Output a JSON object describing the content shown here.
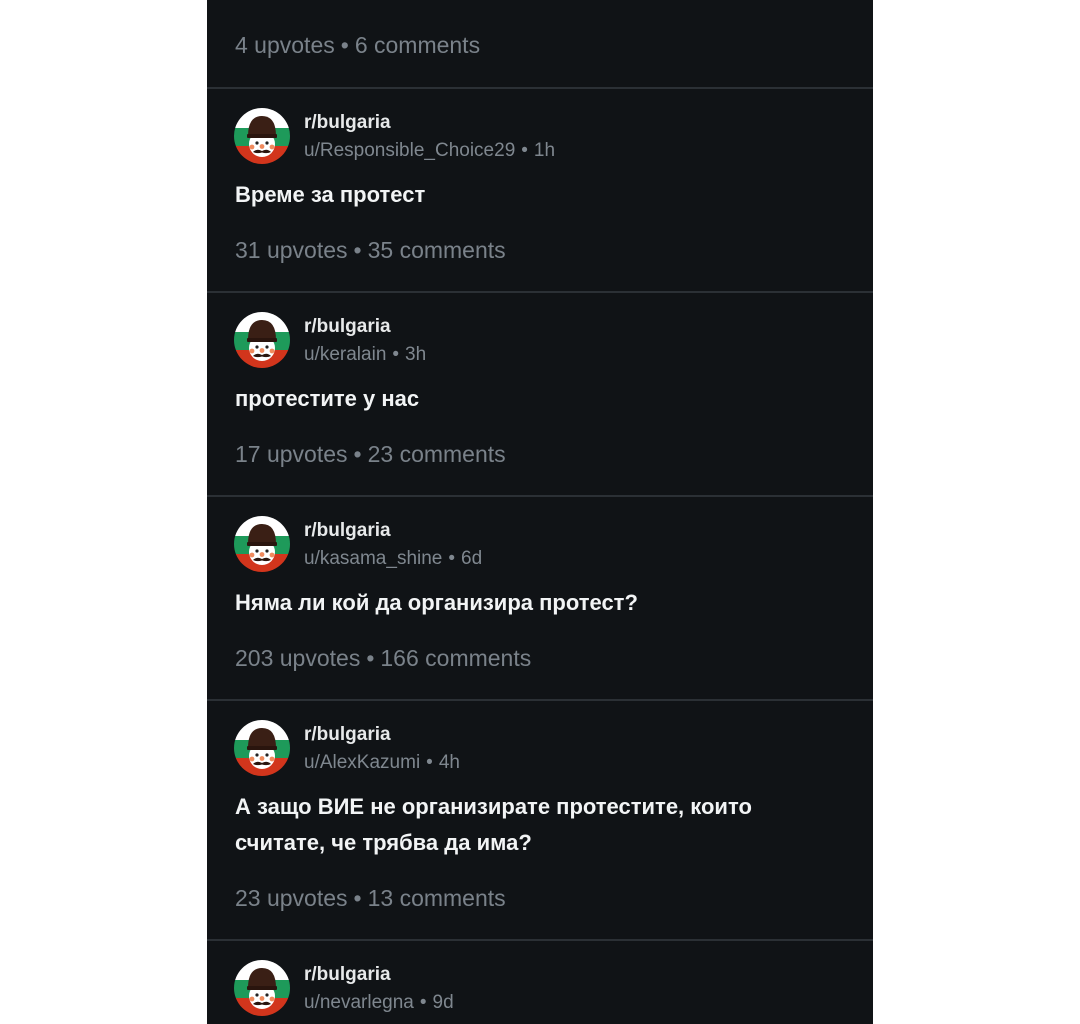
{
  "posts": [
    {
      "upvotes": "4 upvotes",
      "comments": "6 comments"
    },
    {
      "subreddit": "r/bulgaria",
      "user": "u/Responsible_Choice29",
      "age": "1h",
      "title": "Време за протест",
      "upvotes": "31 upvotes",
      "comments": "35 comments"
    },
    {
      "subreddit": "r/bulgaria",
      "user": "u/keralain",
      "age": "3h",
      "title": "протестите у нас",
      "upvotes": "17 upvotes",
      "comments": "23 comments"
    },
    {
      "subreddit": "r/bulgaria",
      "user": "u/kasama_shine",
      "age": "6d",
      "title": "Няма ли кой да организира протест?",
      "upvotes": "203 upvotes",
      "comments": "166 comments"
    },
    {
      "subreddit": "r/bulgaria",
      "user": "u/AlexKazumi",
      "age": "4h",
      "title": "А защо ВИЕ не организирате протестите, които считате, че трябва да има?",
      "upvotes": "23 upvotes",
      "comments": "13 comments"
    },
    {
      "subreddit": "r/bulgaria",
      "user": "u/nevarlegna",
      "age": "9d"
    }
  ],
  "separator": "•",
  "colors": {
    "background": "#101316",
    "divider": "#2b3035",
    "flag_white": "#ffffff",
    "flag_green": "#1e9a5a",
    "flag_red": "#d2351c"
  },
  "icons": {
    "avatar": "bulgaria-community-avatar-icon"
  }
}
